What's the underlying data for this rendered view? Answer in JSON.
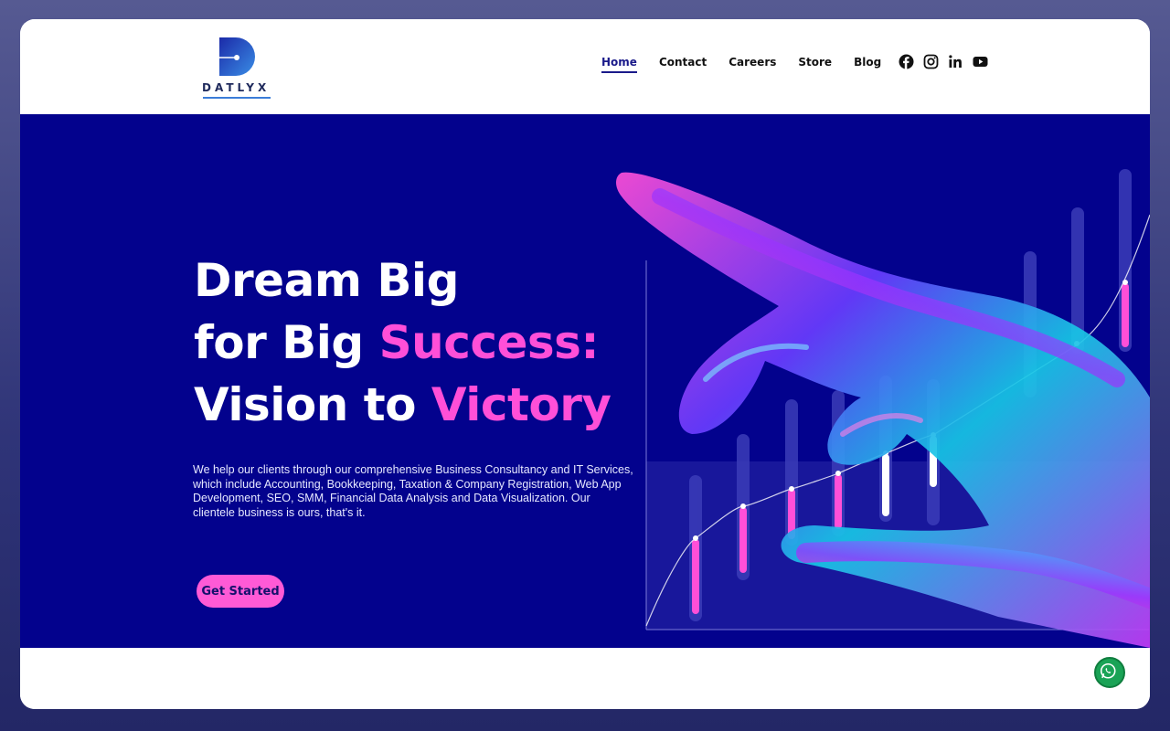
{
  "brand": {
    "logo_letter": "D",
    "name": "DATLYX"
  },
  "nav": {
    "items": [
      {
        "label": "Home",
        "active": true
      },
      {
        "label": "Contact",
        "active": false
      },
      {
        "label": "Careers",
        "active": false
      },
      {
        "label": "Store",
        "active": false
      },
      {
        "label": "Blog",
        "active": false
      }
    ]
  },
  "social": [
    "facebook-icon",
    "instagram-icon",
    "linkedin-icon",
    "youtube-icon"
  ],
  "hero": {
    "line1": "Dream Big",
    "line2_plain": "for Big ",
    "line2_highlight": "Success:",
    "line3_plain": "Vision to ",
    "line3_highlight": "Victory",
    "description": "We help our clients through our comprehensive Business Consultancy and IT Services, which include Accounting, Bookkeeping, Taxation & Company Registration, Web App Development, SEO, SMM, Financial Data Analysis and Data Visualization. Our clientele business is ours, that's it.",
    "cta_label": "Get Started"
  },
  "colors": {
    "hero_bg": "#03028d",
    "accent_pink": "#ff4fd8",
    "nav_active": "#1a1a8a",
    "whatsapp": "#1aa356"
  }
}
